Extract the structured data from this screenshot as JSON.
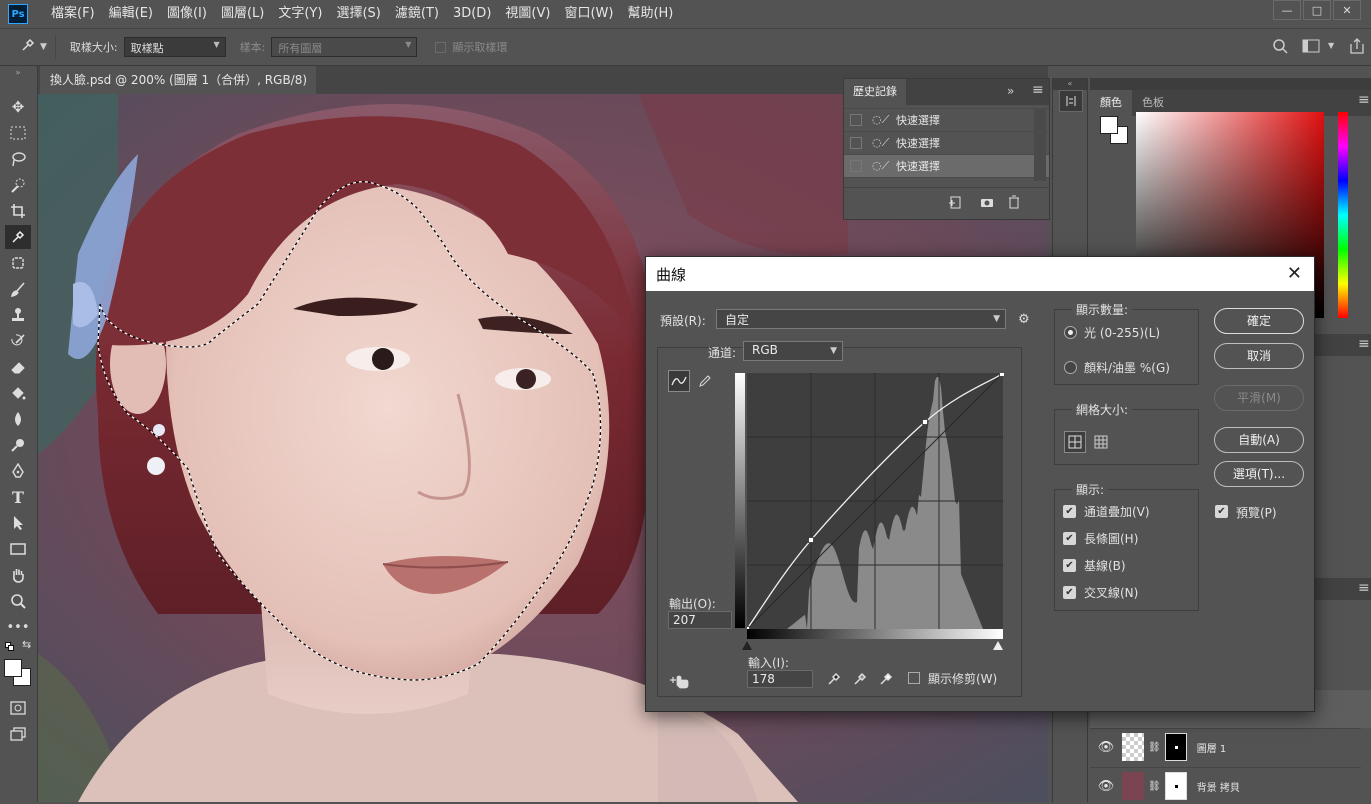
{
  "app": {
    "logo": "Ps",
    "menu": [
      "檔案(F)",
      "編輯(E)",
      "圖像(I)",
      "圖層(L)",
      "文字(Y)",
      "選擇(S)",
      "濾鏡(T)",
      "3D(D)",
      "視圖(V)",
      "窗口(W)",
      "幫助(H)"
    ],
    "window_controls": [
      "—",
      "□",
      "✕"
    ]
  },
  "options_bar": {
    "sample_size_label": "取樣大小:",
    "sample_size_value": "取樣點",
    "sample_label": "樣本:",
    "sample_value": "所有圖層",
    "show_ring_label": "顯示取樣環"
  },
  "document_tab": {
    "title": "換人臉.psd @ 200% (圖層 1（合併）, RGB/8) *",
    "close": "✕"
  },
  "history": {
    "tab_label": "歷史記錄",
    "items": [
      {
        "label": "快速選擇",
        "selected": false
      },
      {
        "label": "快速選擇",
        "selected": false
      },
      {
        "label": "快速選擇",
        "selected": true
      }
    ]
  },
  "color_panel": {
    "tabs": [
      "顏色",
      "色板"
    ]
  },
  "layers": [
    {
      "name": "圖層 1"
    },
    {
      "name": "背景 拷貝"
    }
  ],
  "curves_dialog": {
    "title": "曲線",
    "preset_label": "預設(R):",
    "preset_value": "自定",
    "channel_label": "通道:",
    "channel_value": "RGB",
    "output_label": "輸出(O):",
    "output_value": "207",
    "input_label": "輸入(I):",
    "input_value": "178",
    "show_clipping_label": "顯示修剪(W)",
    "show_amount": {
      "title": "顯示數量:",
      "light": "光 (0-255)(L)",
      "pigment": "顏料/油墨 %(G)"
    },
    "grid_size_title": "網格大小:",
    "display": {
      "title": "顯示:",
      "channel_overlay": "通道疊加(V)",
      "histogram": "長條圖(H)",
      "baseline": "基線(B)",
      "intersection": "交叉線(N)"
    },
    "buttons": {
      "ok": "確定",
      "cancel": "取消",
      "smooth": "平滑(M)",
      "auto": "自動(A)",
      "options": "選項(T)..."
    },
    "preview_label": "預覽(P)",
    "curve_points": [
      [
        0,
        0
      ],
      [
        64,
        89
      ],
      [
        178,
        207
      ],
      [
        255,
        255
      ]
    ]
  }
}
